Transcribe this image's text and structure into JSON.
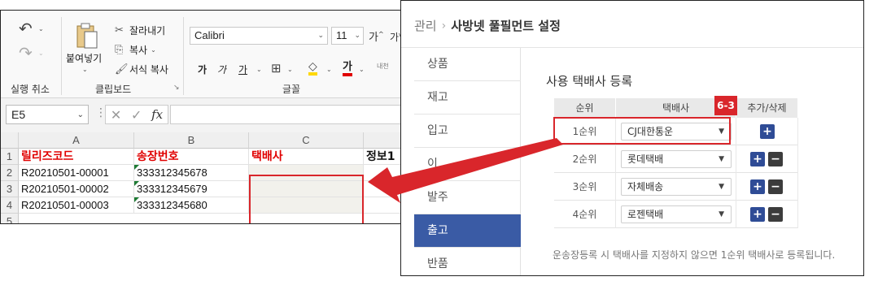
{
  "excel": {
    "undo_label": "실행 취소",
    "clipboard": {
      "group_label": "클립보드",
      "paste_label": "붙여넣기",
      "cut_label": "잘라내기",
      "copy_label": "복사",
      "format_painter_label": "서식 복사"
    },
    "font": {
      "group_label": "글꼴",
      "font_name": "Calibri",
      "font_size": "11",
      "bold_label": "가",
      "italic_label": "가",
      "underline_label": "가",
      "font_color_label": "가",
      "grow_label": "가",
      "shrink_label": "가",
      "phonetic_label": "내천"
    },
    "name_box": "E5",
    "columns": [
      "A",
      "B",
      "C"
    ],
    "rows": [
      "1",
      "2",
      "3",
      "4",
      "5"
    ],
    "headers": {
      "a1": "릴리즈코드",
      "b1": "송장번호",
      "c1": "택배사",
      "d1": "정보1"
    },
    "data_rows": [
      {
        "release_code": "R20210501-00001",
        "invoice": "333312345678"
      },
      {
        "release_code": "R20210501-00002",
        "invoice": "333312345679"
      },
      {
        "release_code": "R20210501-00003",
        "invoice": "333312345680"
      }
    ],
    "colors": {
      "header_red": "#e00000",
      "selection_red": "#d9262b",
      "error_triangle": "#1e7b34"
    }
  },
  "admin": {
    "breadcrumb": {
      "parent": "관리",
      "current": "사방넷 풀필먼트 설정"
    },
    "sidebar": [
      {
        "label": "상품"
      },
      {
        "label": "재고"
      },
      {
        "label": "입고"
      },
      {
        "label": "이"
      },
      {
        "label": "발주"
      },
      {
        "label": "출고",
        "active": true
      },
      {
        "label": "반품"
      }
    ],
    "section_title": "사용 택배사 등록",
    "tag": "6-3",
    "table": {
      "headers": [
        "순위",
        "택배사",
        "추가/삭제"
      ],
      "rows": [
        {
          "rank": "1순위",
          "courier": "CJ대한통운",
          "add": "+",
          "remove": ""
        },
        {
          "rank": "2순위",
          "courier": "롯데택배",
          "add": "+",
          "remove": "−"
        },
        {
          "rank": "3순위",
          "courier": "자체배송",
          "add": "+",
          "remove": "−"
        },
        {
          "rank": "4순위",
          "courier": "로젠택배",
          "add": "+",
          "remove": "−"
        }
      ]
    },
    "note": "운송장등록 시 택배사를 지정하지 않으면 1순위 택배사로 등록됩니다.",
    "colors": {
      "active_menu": "#3a5ba5",
      "plus_button": "#2f4c96",
      "minus_button": "#3c3c3c",
      "highlight": "#d9262b"
    }
  }
}
